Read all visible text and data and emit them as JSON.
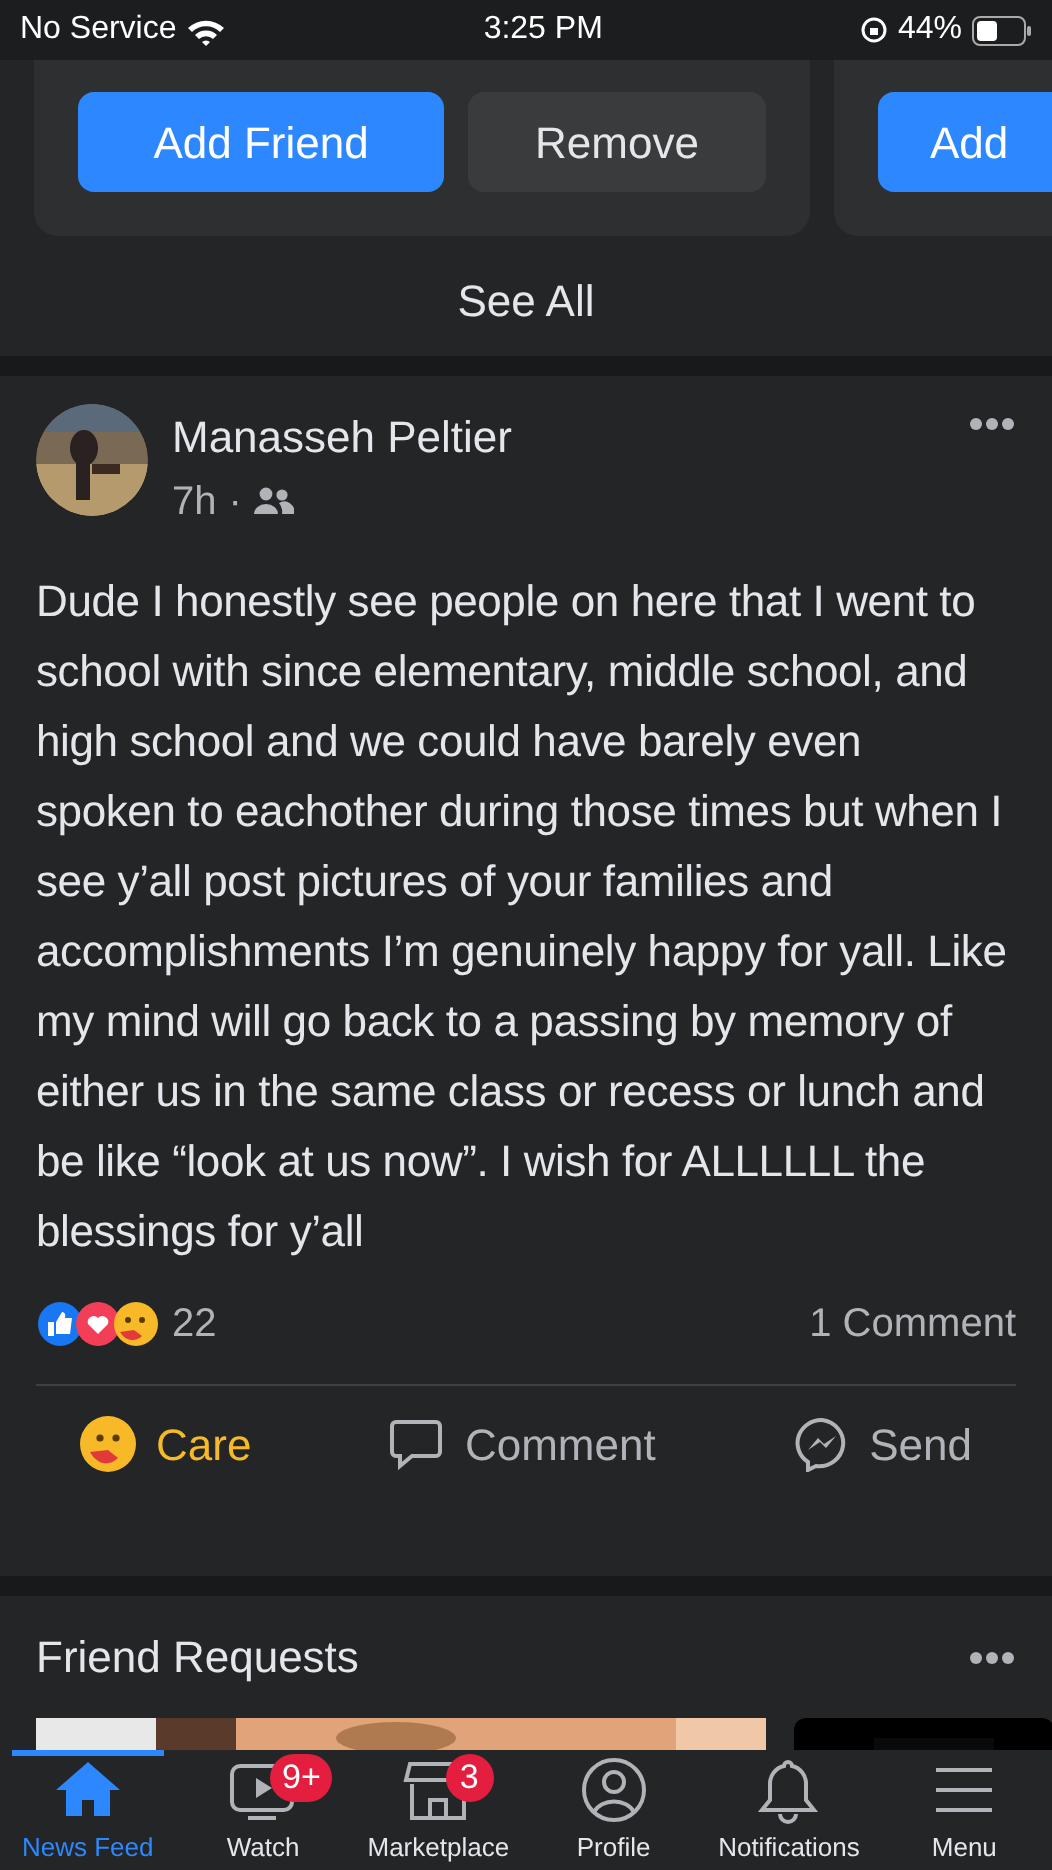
{
  "status_bar": {
    "carrier": "No Service",
    "time": "3:25 PM",
    "battery": "44%"
  },
  "suggestions": {
    "cards": [
      {
        "buttons": [
          {
            "label": "Add Friend",
            "kind": "primary"
          },
          {
            "label": "Remove",
            "kind": "secondary"
          }
        ]
      },
      {
        "buttons": [
          {
            "label": "Add",
            "kind": "primary"
          }
        ]
      }
    ],
    "see_all": "See All"
  },
  "post": {
    "author": "Manasseh Peltier",
    "time": "7h",
    "separator": "·",
    "text": "Dude I honestly see people on here that I went to school with since elementary, middle school, and high school and we could have barely even spoken to eachother during those times but when I see y’all post pictures of your families and accomplishments I’m genuinely happy for yall. Like my mind will go back to a passing by memory of either us in the same class or recess or lunch and be like “look at us now”. I wish for ALLLLLL the blessings for y’all",
    "reaction_count": "22",
    "comment_count": "1 Comment",
    "actions": [
      {
        "label": "Care",
        "kind": "care",
        "active": true
      },
      {
        "label": "Comment",
        "kind": "comment",
        "active": false
      },
      {
        "label": "Send",
        "kind": "send",
        "active": false
      }
    ]
  },
  "friend_requests": {
    "title": "Friend Requests"
  },
  "tab_bar": [
    {
      "label": "News Feed",
      "kind": "home",
      "selected": true
    },
    {
      "label": "Watch",
      "kind": "watch",
      "selected": false,
      "badge": "9+"
    },
    {
      "label": "Marketplace",
      "kind": "market",
      "selected": false,
      "badge": "3"
    },
    {
      "label": "Profile",
      "kind": "profile",
      "selected": false
    },
    {
      "label": "Notifications",
      "kind": "bell",
      "selected": false
    },
    {
      "label": "Menu",
      "kind": "menu",
      "selected": false
    }
  ]
}
